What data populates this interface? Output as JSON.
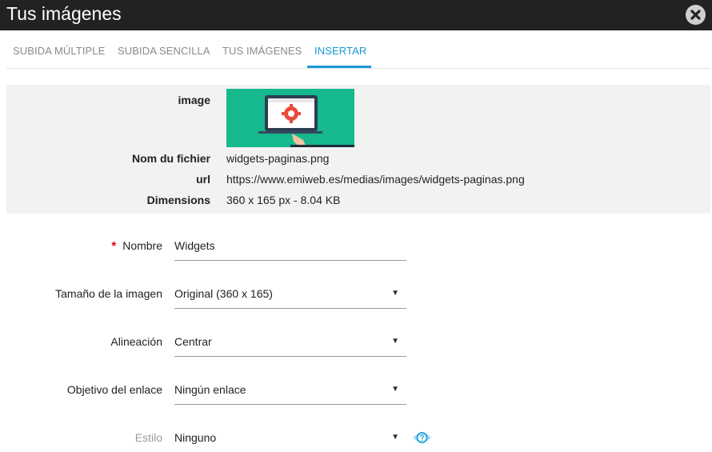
{
  "window": {
    "title": "Tus imágenes"
  },
  "tabs": [
    {
      "label": "SUBIDA MÚLTIPLE"
    },
    {
      "label": "SUBIDA SENCILLA"
    },
    {
      "label": "TUS IMÁGENES"
    },
    {
      "label": "INSERTAR"
    }
  ],
  "active_tab": "INSERTAR",
  "file_info": {
    "image_label": "image",
    "filename_label": "Nom du fichier",
    "filename": "widgets-paginas.png",
    "url_label": "url",
    "url": "https://www.emiweb.es/medias/images/widgets-paginas.png",
    "dimensions_label": "Dimensions",
    "dimensions": "360 x 165 px - 8.04 KB"
  },
  "form": {
    "required_mark": "*",
    "nombre_label": "Nombre",
    "nombre_value": "Widgets",
    "size_label": "Tamaño de la imagen",
    "size_value": "Original (360 x 165)",
    "align_label": "Alineación",
    "align_value": "Centrar",
    "link_label": "Objetivo del enlace",
    "link_value": "Ningún enlace",
    "style_label": "Estilo",
    "style_value": "Ninguno",
    "dropdown_arrow": "▼"
  },
  "colors": {
    "title_bar": "#222222",
    "accent": "#1a9ad6",
    "info_bg": "#f2f2f2",
    "thumb_bg": "#16b98e",
    "required": "#d0021b"
  },
  "icons": {
    "close": "close-icon",
    "help": "help-eye-icon",
    "dropdown": "chevron-down-icon"
  }
}
